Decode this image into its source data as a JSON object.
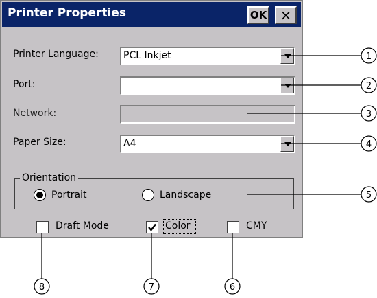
{
  "dialog": {
    "title": "Printer Properties",
    "ok_label": "OK",
    "close_label": "×"
  },
  "fields": {
    "printer_language": {
      "label": "Printer Language:",
      "value": "PCL Inkjet"
    },
    "port": {
      "label": "Port:",
      "value": ""
    },
    "network": {
      "label": "Network:",
      "value": ""
    },
    "paper_size": {
      "label": "Paper Size:",
      "value": "A4"
    }
  },
  "orientation": {
    "title": "Orientation",
    "portrait": {
      "label": "Portrait",
      "selected": true
    },
    "landscape": {
      "label": "Landscape",
      "selected": false
    }
  },
  "options": {
    "draft_mode": {
      "label": "Draft Mode",
      "checked": false
    },
    "color": {
      "label": "Color",
      "checked": true
    },
    "cmy": {
      "label": "CMY",
      "checked": false
    }
  },
  "callouts": [
    "1",
    "2",
    "3",
    "4",
    "5",
    "6",
    "7",
    "8"
  ],
  "colors": {
    "titlebar": "#0a2468",
    "dialog_bg": "#c6c3c6"
  }
}
